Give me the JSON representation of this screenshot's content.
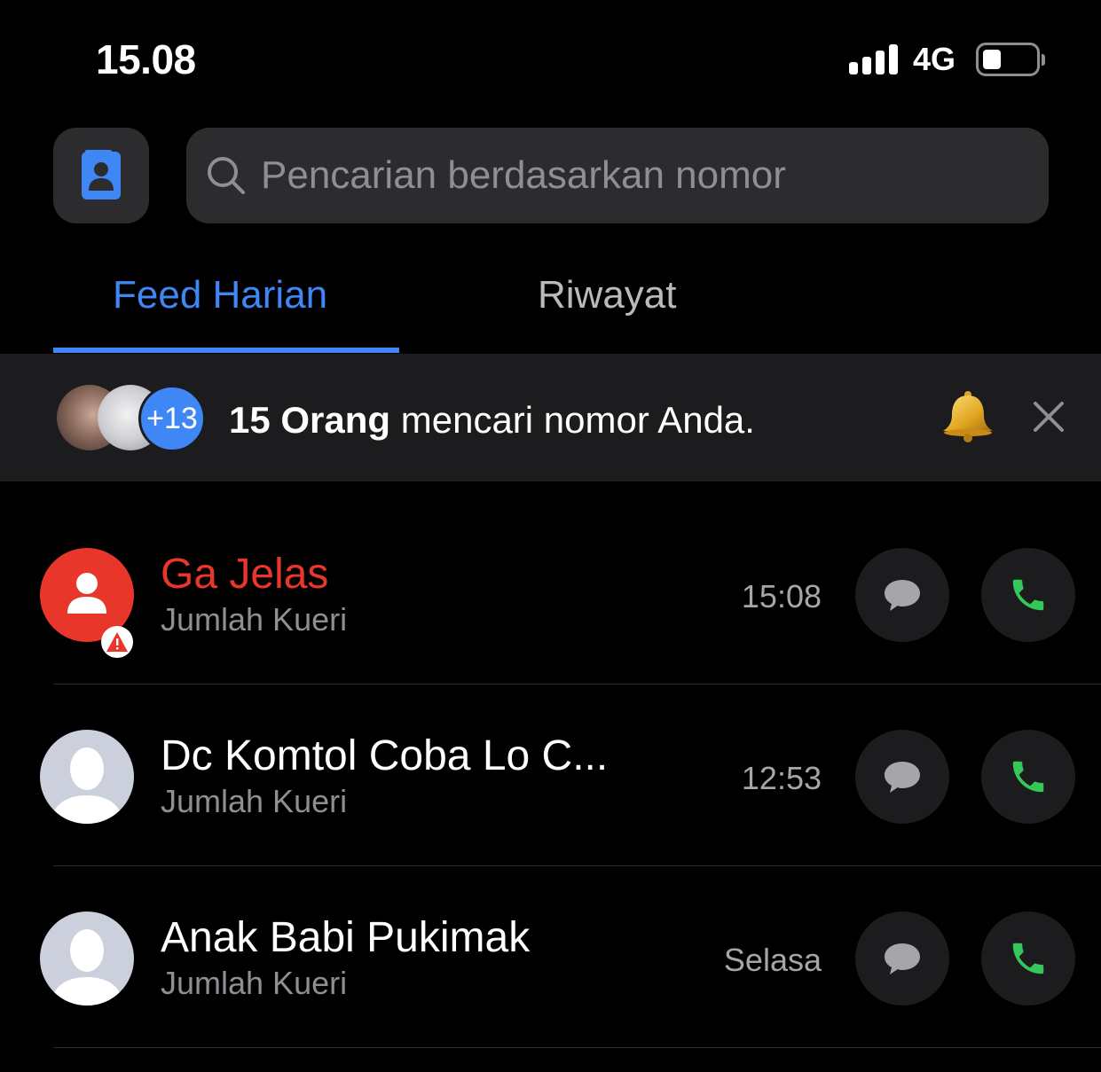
{
  "status_bar": {
    "time": "15.08",
    "network": "4G"
  },
  "search": {
    "placeholder": "Pencarian berdasarkan nomor"
  },
  "tabs": [
    {
      "label": "Feed Harian",
      "active": true
    },
    {
      "label": "Riwayat",
      "active": false
    }
  ],
  "banner": {
    "extra_count": "+13",
    "count_text": "15 Orang",
    "message": " mencari nomor Anda."
  },
  "entries": [
    {
      "name": "Ga Jelas",
      "subtitle": "Jumlah Kueri",
      "time": "15:08",
      "name_color": "#e8362b",
      "spam": true
    },
    {
      "name": "Dc Komtol Coba Lo C...",
      "subtitle": "Jumlah Kueri",
      "time": "12:53",
      "name_color": "#ffffff",
      "spam": false
    },
    {
      "name": "Anak Babi Pukimak",
      "subtitle": "Jumlah Kueri",
      "time": "Selasa",
      "name_color": "#ffffff",
      "spam": false
    }
  ],
  "colors": {
    "accent": "#3f87f5",
    "spam": "#e8362b",
    "call": "#34c759"
  }
}
